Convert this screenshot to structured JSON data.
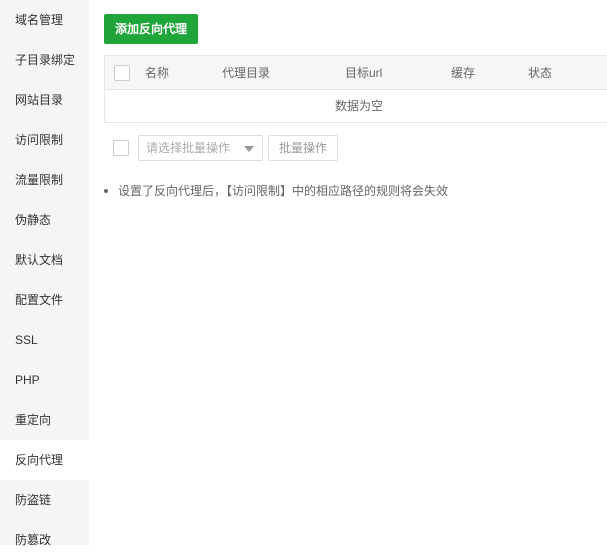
{
  "sidebar": {
    "items": [
      {
        "label": "域名管理"
      },
      {
        "label": "子目录绑定"
      },
      {
        "label": "网站目录"
      },
      {
        "label": "访问限制"
      },
      {
        "label": "流量限制"
      },
      {
        "label": "伪静态"
      },
      {
        "label": "默认文档"
      },
      {
        "label": "配置文件"
      },
      {
        "label": "SSL"
      },
      {
        "label": "PHP"
      },
      {
        "label": "重定向"
      },
      {
        "label": "反向代理"
      },
      {
        "label": "防盗链"
      },
      {
        "label": "防篡改"
      }
    ],
    "active_index": 11
  },
  "toolbar": {
    "add_label": "添加反向代理"
  },
  "table": {
    "columns": [
      "名称",
      "代理目录",
      "目标url",
      "缓存",
      "状态"
    ],
    "empty_text": "数据为空"
  },
  "batch": {
    "select_placeholder": "请选择批量操作",
    "button_label": "批量操作"
  },
  "tips": [
    "设置了反向代理后，【访问限制】中的相应路径的规则将会失效"
  ],
  "colors": {
    "accent": "#20a53a"
  }
}
